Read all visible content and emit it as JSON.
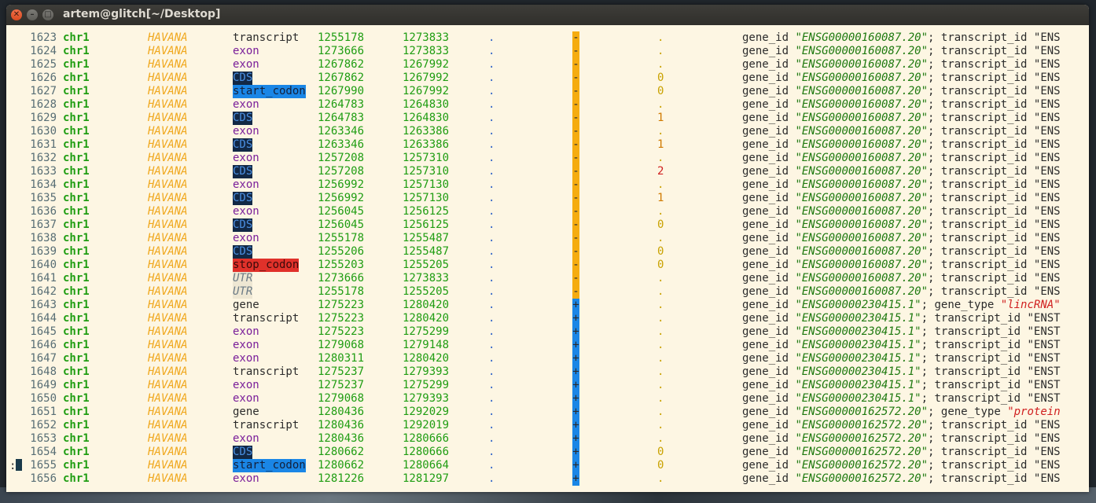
{
  "window": {
    "title": "artem@glitch[~/Desktop]"
  },
  "rows": [
    {
      "n": "1623",
      "chr": "chr1",
      "src": "HAVANA",
      "feat": "transcript",
      "start": "1255178",
      "end": "1273833",
      "score": ".",
      "strand": "-",
      "frame": ".",
      "gid": "\"ENSG00000160087.20\"",
      "tail": "; transcript_id \"ENS"
    },
    {
      "n": "1624",
      "chr": "chr1",
      "src": "HAVANA",
      "feat": "exon",
      "start": "1273666",
      "end": "1273833",
      "score": ".",
      "strand": "-",
      "frame": ".",
      "gid": "\"ENSG00000160087.20\"",
      "tail": "; transcript_id \"ENS"
    },
    {
      "n": "1625",
      "chr": "chr1",
      "src": "HAVANA",
      "feat": "exon",
      "start": "1267862",
      "end": "1267992",
      "score": ".",
      "strand": "-",
      "frame": ".",
      "gid": "\"ENSG00000160087.20\"",
      "tail": "; transcript_id \"ENS"
    },
    {
      "n": "1626",
      "chr": "chr1",
      "src": "HAVANA",
      "feat": "CDS",
      "start": "1267862",
      "end": "1267992",
      "score": ".",
      "strand": "-",
      "frame": "0",
      "gid": "\"ENSG00000160087.20\"",
      "tail": "; transcript_id \"ENS"
    },
    {
      "n": "1627",
      "chr": "chr1",
      "src": "HAVANA",
      "feat": "start_codon",
      "start": "1267990",
      "end": "1267992",
      "score": ".",
      "strand": "-",
      "frame": "0",
      "gid": "\"ENSG00000160087.20\"",
      "tail": "; transcript_id \"ENS"
    },
    {
      "n": "1628",
      "chr": "chr1",
      "src": "HAVANA",
      "feat": "exon",
      "start": "1264783",
      "end": "1264830",
      "score": ".",
      "strand": "-",
      "frame": ".",
      "gid": "\"ENSG00000160087.20\"",
      "tail": "; transcript_id \"ENS"
    },
    {
      "n": "1629",
      "chr": "chr1",
      "src": "HAVANA",
      "feat": "CDS",
      "start": "1264783",
      "end": "1264830",
      "score": ".",
      "strand": "-",
      "frame": "1",
      "gid": "\"ENSG00000160087.20\"",
      "tail": "; transcript_id \"ENS"
    },
    {
      "n": "1630",
      "chr": "chr1",
      "src": "HAVANA",
      "feat": "exon",
      "start": "1263346",
      "end": "1263386",
      "score": ".",
      "strand": "-",
      "frame": ".",
      "gid": "\"ENSG00000160087.20\"",
      "tail": "; transcript_id \"ENS"
    },
    {
      "n": "1631",
      "chr": "chr1",
      "src": "HAVANA",
      "feat": "CDS",
      "start": "1263346",
      "end": "1263386",
      "score": ".",
      "strand": "-",
      "frame": "1",
      "gid": "\"ENSG00000160087.20\"",
      "tail": "; transcript_id \"ENS"
    },
    {
      "n": "1632",
      "chr": "chr1",
      "src": "HAVANA",
      "feat": "exon",
      "start": "1257208",
      "end": "1257310",
      "score": ".",
      "strand": "-",
      "frame": ".",
      "gid": "\"ENSG00000160087.20\"",
      "tail": "; transcript_id \"ENS"
    },
    {
      "n": "1633",
      "chr": "chr1",
      "src": "HAVANA",
      "feat": "CDS",
      "start": "1257208",
      "end": "1257310",
      "score": ".",
      "strand": "-",
      "frame": "2",
      "gid": "\"ENSG00000160087.20\"",
      "tail": "; transcript_id \"ENS"
    },
    {
      "n": "1634",
      "chr": "chr1",
      "src": "HAVANA",
      "feat": "exon",
      "start": "1256992",
      "end": "1257130",
      "score": ".",
      "strand": "-",
      "frame": ".",
      "gid": "\"ENSG00000160087.20\"",
      "tail": "; transcript_id \"ENS"
    },
    {
      "n": "1635",
      "chr": "chr1",
      "src": "HAVANA",
      "feat": "CDS",
      "start": "1256992",
      "end": "1257130",
      "score": ".",
      "strand": "-",
      "frame": "1",
      "gid": "\"ENSG00000160087.20\"",
      "tail": "; transcript_id \"ENS"
    },
    {
      "n": "1636",
      "chr": "chr1",
      "src": "HAVANA",
      "feat": "exon",
      "start": "1256045",
      "end": "1256125",
      "score": ".",
      "strand": "-",
      "frame": ".",
      "gid": "\"ENSG00000160087.20\"",
      "tail": "; transcript_id \"ENS"
    },
    {
      "n": "1637",
      "chr": "chr1",
      "src": "HAVANA",
      "feat": "CDS",
      "start": "1256045",
      "end": "1256125",
      "score": ".",
      "strand": "-",
      "frame": "0",
      "gid": "\"ENSG00000160087.20\"",
      "tail": "; transcript_id \"ENS"
    },
    {
      "n": "1638",
      "chr": "chr1",
      "src": "HAVANA",
      "feat": "exon",
      "start": "1255178",
      "end": "1255487",
      "score": ".",
      "strand": "-",
      "frame": ".",
      "gid": "\"ENSG00000160087.20\"",
      "tail": "; transcript_id \"ENS"
    },
    {
      "n": "1639",
      "chr": "chr1",
      "src": "HAVANA",
      "feat": "CDS",
      "start": "1255206",
      "end": "1255487",
      "score": ".",
      "strand": "-",
      "frame": "0",
      "gid": "\"ENSG00000160087.20\"",
      "tail": "; transcript_id \"ENS"
    },
    {
      "n": "1640",
      "chr": "chr1",
      "src": "HAVANA",
      "feat": "stop_codon",
      "start": "1255203",
      "end": "1255205",
      "score": ".",
      "strand": "-",
      "frame": "0",
      "gid": "\"ENSG00000160087.20\"",
      "tail": "; transcript_id \"ENS"
    },
    {
      "n": "1641",
      "chr": "chr1",
      "src": "HAVANA",
      "feat": "UTR",
      "start": "1273666",
      "end": "1273833",
      "score": ".",
      "strand": "-",
      "frame": ".",
      "gid": "\"ENSG00000160087.20\"",
      "tail": "; transcript_id \"ENS"
    },
    {
      "n": "1642",
      "chr": "chr1",
      "src": "HAVANA",
      "feat": "UTR",
      "start": "1255178",
      "end": "1255205",
      "score": ".",
      "strand": "-",
      "frame": ".",
      "gid": "\"ENSG00000160087.20\"",
      "tail": "; transcript_id \"ENS"
    },
    {
      "n": "1643",
      "chr": "chr1",
      "src": "HAVANA",
      "feat": "gene",
      "start": "1275223",
      "end": "1280420",
      "score": ".",
      "strand": "+",
      "frame": ".",
      "gid": "\"ENSG00000230415.1\"",
      "tail": "; gene_type ",
      "red": "\"lincRNA\""
    },
    {
      "n": "1644",
      "chr": "chr1",
      "src": "HAVANA",
      "feat": "transcript",
      "start": "1275223",
      "end": "1280420",
      "score": ".",
      "strand": "+",
      "frame": ".",
      "gid": "\"ENSG00000230415.1\"",
      "tail": "; transcript_id \"ENST"
    },
    {
      "n": "1645",
      "chr": "chr1",
      "src": "HAVANA",
      "feat": "exon",
      "start": "1275223",
      "end": "1275299",
      "score": ".",
      "strand": "+",
      "frame": ".",
      "gid": "\"ENSG00000230415.1\"",
      "tail": "; transcript_id \"ENST"
    },
    {
      "n": "1646",
      "chr": "chr1",
      "src": "HAVANA",
      "feat": "exon",
      "start": "1279068",
      "end": "1279148",
      "score": ".",
      "strand": "+",
      "frame": ".",
      "gid": "\"ENSG00000230415.1\"",
      "tail": "; transcript_id \"ENST"
    },
    {
      "n": "1647",
      "chr": "chr1",
      "src": "HAVANA",
      "feat": "exon",
      "start": "1280311",
      "end": "1280420",
      "score": ".",
      "strand": "+",
      "frame": ".",
      "gid": "\"ENSG00000230415.1\"",
      "tail": "; transcript_id \"ENST"
    },
    {
      "n": "1648",
      "chr": "chr1",
      "src": "HAVANA",
      "feat": "transcript",
      "start": "1275237",
      "end": "1279393",
      "score": ".",
      "strand": "+",
      "frame": ".",
      "gid": "\"ENSG00000230415.1\"",
      "tail": "; transcript_id \"ENST"
    },
    {
      "n": "1649",
      "chr": "chr1",
      "src": "HAVANA",
      "feat": "exon",
      "start": "1275237",
      "end": "1275299",
      "score": ".",
      "strand": "+",
      "frame": ".",
      "gid": "\"ENSG00000230415.1\"",
      "tail": "; transcript_id \"ENST"
    },
    {
      "n": "1650",
      "chr": "chr1",
      "src": "HAVANA",
      "feat": "exon",
      "start": "1279068",
      "end": "1279393",
      "score": ".",
      "strand": "+",
      "frame": ".",
      "gid": "\"ENSG00000230415.1\"",
      "tail": "; transcript_id \"ENST"
    },
    {
      "n": "1651",
      "chr": "chr1",
      "src": "HAVANA",
      "feat": "gene",
      "start": "1280436",
      "end": "1292029",
      "score": ".",
      "strand": "+",
      "frame": ".",
      "gid": "\"ENSG00000162572.20\"",
      "tail": "; gene_type ",
      "red": "\"protein"
    },
    {
      "n": "1652",
      "chr": "chr1",
      "src": "HAVANA",
      "feat": "transcript",
      "start": "1280436",
      "end": "1292019",
      "score": ".",
      "strand": "+",
      "frame": ".",
      "gid": "\"ENSG00000162572.20\"",
      "tail": "; transcript_id \"ENS"
    },
    {
      "n": "1653",
      "chr": "chr1",
      "src": "HAVANA",
      "feat": "exon",
      "start": "1280436",
      "end": "1280666",
      "score": ".",
      "strand": "+",
      "frame": ".",
      "gid": "\"ENSG00000162572.20\"",
      "tail": "; transcript_id \"ENS"
    },
    {
      "n": "1654",
      "chr": "chr1",
      "src": "HAVANA",
      "feat": "CDS",
      "start": "1280662",
      "end": "1280666",
      "score": ".",
      "strand": "+",
      "frame": "0",
      "gid": "\"ENSG00000162572.20\"",
      "tail": "; transcript_id \"ENS"
    },
    {
      "n": "1655",
      "chr": "chr1",
      "src": "HAVANA",
      "feat": "start_codon",
      "start": "1280662",
      "end": "1280664",
      "score": ".",
      "strand": "+",
      "frame": "0",
      "gid": "\"ENSG00000162572.20\"",
      "tail": "; transcript_id \"ENS"
    },
    {
      "n": "1656",
      "chr": "chr1",
      "src": "HAVANA",
      "feat": "exon",
      "start": "1281226",
      "end": "1281297",
      "score": ".",
      "strand": "+",
      "frame": ".",
      "gid": "\"ENSG00000162572.20\"",
      "tail": "; transcript_id \"ENS"
    }
  ],
  "attr_key": "gene_id",
  "prompt": ":",
  "colors": {
    "minus_strand": "#f5ac10",
    "plus_strand": "#1a86e6",
    "background": "#fdf6e3"
  }
}
